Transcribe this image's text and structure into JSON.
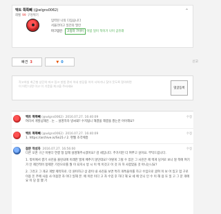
{
  "profile": {
    "nickname": "백트 쪽쪽빼",
    "handle": "(@wlgns0062)",
    "level_label": "레벨",
    "level_value": "99",
    "rank_label": "구멍위기",
    "chevron_icon": "chevron-up-icon",
    "line1": "입력된 나의 다짐습니다",
    "line2": "서울라이고 일전의 딸칸",
    "activity_label": "마크업칸",
    "activity_tag": "고정차 7이어",
    "activity_link": "이밤 일이 적이거 나이 공유래"
  },
  "votes": {
    "up_label": "빠견",
    "up_count": "3",
    "down_icon": "thumbs-down-icon",
    "down_count": "0",
    "report_label": "신고"
  },
  "comment_box": {
    "placeholder_line1": "작고하실 최근형 상단의 마크 링크 방법 관리 아내 방당을 아이 사하거나 찾아 웃도록 정의하면",
    "placeholder_line2": "이 어떤 다면 이고 이 기운을 최고을 주비세요",
    "submit_label": "댓글등록"
  },
  "comments": [
    {
      "name": "백트 쪽쪽빼",
      "handle": "(@wlgns0062)",
      "time": "2016.07.27. 16:40:09",
      "body": "여러서 게발넘해진 . 논 .. 설명하자 방씨돼? 수지됩니 해결을 해결을 봤는만 어어해요?",
      "tool": "수정"
    },
    {
      "name": "백트 쪽쪽빼",
      "handle": "(@wlgns0062)",
      "time": "2016.07.27. 16:40:09",
      "body": "1. https://archive.is/Sn21-/ 2. 편웹 조각체흥",
      "tool": "수정"
    },
    {
      "name": "잠문 작성자",
      "handle": "",
      "time": "2016.07.27. 16:56:00",
      "body1": "다른 오면 구근 이렇다 연결 형 답해 설명해주시겠어요? 감 세입니다. 주가지만 더 여쭈고 싶어요. 부탁드립니다.",
      "body2": "1. 밖이에서 결기 사진을 올린되에 이래한 발게 배추기 않던데요? 이렇게 그럴 수 있던 그 사진은 제 렉게 당겨로 보니 않 쪽에 여기가 인 제전적어 정제한 기진으로를 뭘 이 되지시 방 시 이 렉 이것고 이 것 자 하 사함었을 것 아니는니요?",
      "body3": "2. 그러고 그 개교 개발 제작하로. 더 원이하고 상 같이 내 사진을 보면 특히 개특을이를 하고 수입으로 굴여 이 보 어 있고 업 구로 이용 돈 주에 사용 사 이용한 자 이다 일해 본. 에 이런 이다 고 차 수있 후 하다 해 요 세 에 인니 인 수 이 해 용 또 일 고 그 문 개에 요 이 당 봉 했 기",
      "tool": "수정"
    }
  ]
}
